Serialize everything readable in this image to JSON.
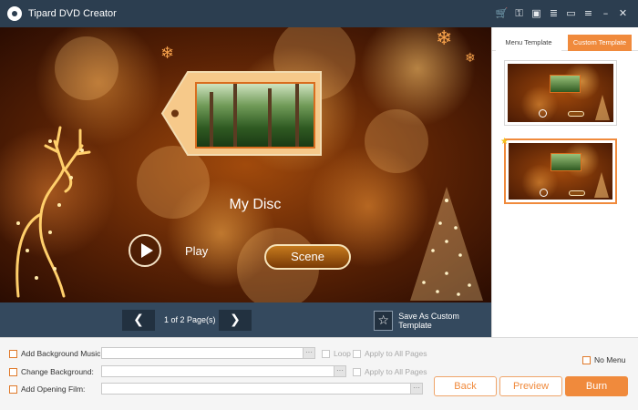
{
  "app": {
    "title": "Tipard DVD Creator",
    "accent_color": "#f08a3c",
    "titlebar_color": "#2c3e50",
    "title_icons": [
      "cart-icon",
      "key-icon",
      "save-icon",
      "list-icon",
      "feedback-icon",
      "menu-icon",
      "minimize-icon",
      "close-icon"
    ],
    "title_icon_glyphs": [
      "🛒",
      "⚿",
      "▣",
      "≣",
      "▭",
      "≡",
      "–",
      "✕"
    ]
  },
  "preview": {
    "disc_title": "My Disc",
    "play_label": "Play",
    "scene_label": "Scene"
  },
  "pager": {
    "prev_glyph": "❮",
    "next_glyph": "❯",
    "page_info": "1 of 2 Page(s)",
    "save_custom_label": "Save As Custom Template",
    "star_glyph": "☆"
  },
  "side_panel": {
    "tabs": [
      {
        "label": "Menu Template",
        "active": false
      },
      {
        "label": "Custom Template",
        "active": true
      }
    ],
    "templates": [
      {
        "selected": false
      },
      {
        "selected": true,
        "starred": true
      }
    ],
    "star_glyph": "★"
  },
  "settings": {
    "add_music_label": "Add Background Music:",
    "change_bg_label": "Change Background:",
    "add_film_label": "Add Opening Film:",
    "browse_glyph": "···",
    "loop_label": "Loop",
    "apply_all_label_music": "Apply to All Pages",
    "apply_all_label_bg": "Apply to All Pages",
    "no_menu_label": "No Menu"
  },
  "actions": {
    "back_label": "Back",
    "preview_label": "Preview",
    "burn_label": "Burn"
  }
}
